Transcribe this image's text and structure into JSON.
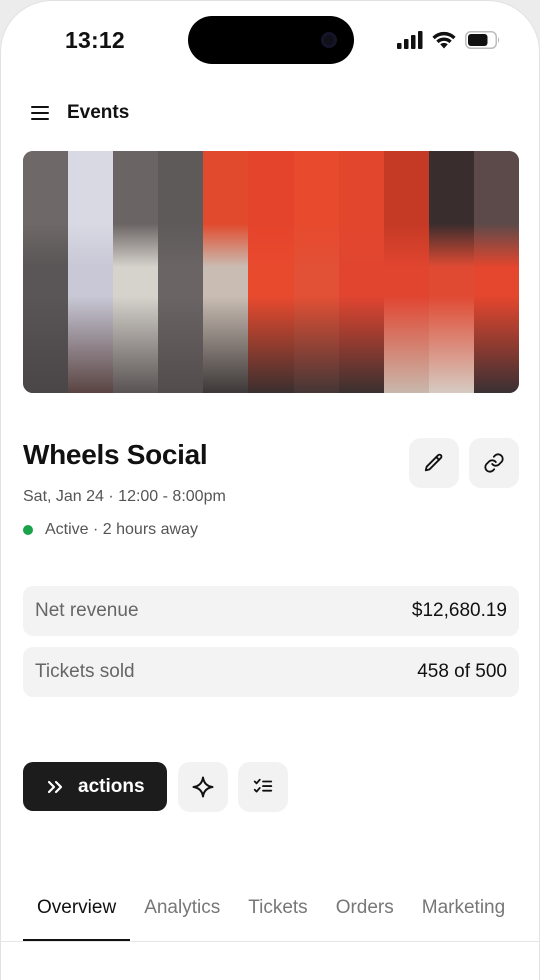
{
  "status_bar": {
    "time": "13:12",
    "battery_level": 0.75
  },
  "header": {
    "title": "Events",
    "menu_icon": "hamburger-menu-icon"
  },
  "cover": {
    "description_icon": "event-cover-image",
    "palette": [
      "#5a5556",
      "#c8c8d6",
      "#6b6464",
      "#5f5a5a",
      "#b8ada4",
      "#e5442c",
      "#e84a2e",
      "#e2472d",
      "#e14530",
      "#c94a36",
      "#5c4a4a"
    ]
  },
  "event": {
    "title": "Wheels Social",
    "date": "Sat, Jan 24 · 12:00 - 8:00pm",
    "status": "Active · 2 hours away",
    "status_color": "#1aa34a"
  },
  "stats": [
    {
      "label": "Net revenue",
      "value": "$12,680.19"
    },
    {
      "label": "Tickets sold",
      "value": "458 of 500"
    }
  ],
  "actions": {
    "label": "actions"
  },
  "tabs": [
    {
      "label": "Overview",
      "active": true
    },
    {
      "label": "Analytics",
      "active": false
    },
    {
      "label": "Tickets",
      "active": false
    },
    {
      "label": "Orders",
      "active": false
    },
    {
      "label": "Marketing",
      "active": false
    }
  ]
}
